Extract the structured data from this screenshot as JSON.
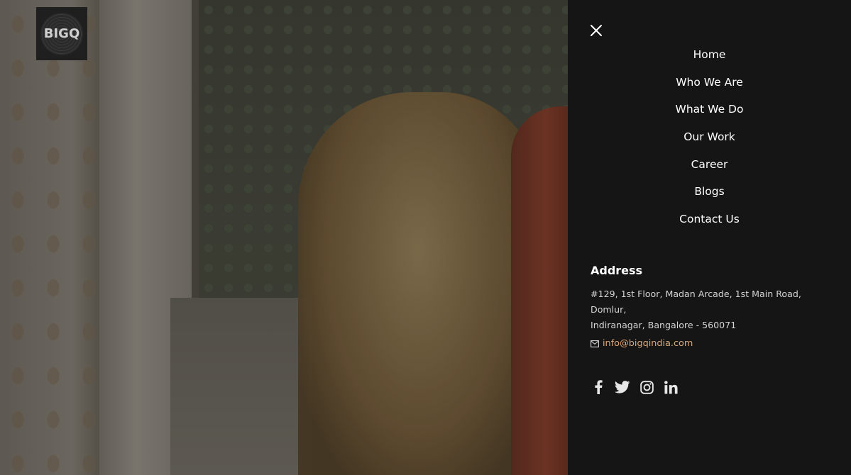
{
  "brand": {
    "logo_text": "BIGQ"
  },
  "menu": {
    "items": [
      {
        "label": "Home"
      },
      {
        "label": "Who We Are"
      },
      {
        "label": "What We Do"
      },
      {
        "label": "Our Work"
      },
      {
        "label": "Career"
      },
      {
        "label": "Blogs"
      },
      {
        "label": "Contact Us"
      }
    ]
  },
  "contact": {
    "address_title": "Address",
    "address_line1": "#129, 1st Floor, Madan Arcade, 1st Main Road, Domlur,",
    "address_line2": "Indiranagar, Bangalore - 560071",
    "email": "info@bigqindia.com"
  },
  "social": [
    "facebook-icon",
    "twitter-icon",
    "instagram-icon",
    "linkedin-icon"
  ],
  "colors": {
    "panel_bg": "#151515",
    "link_accent": "#d9a77a",
    "text": "#ffffff"
  }
}
